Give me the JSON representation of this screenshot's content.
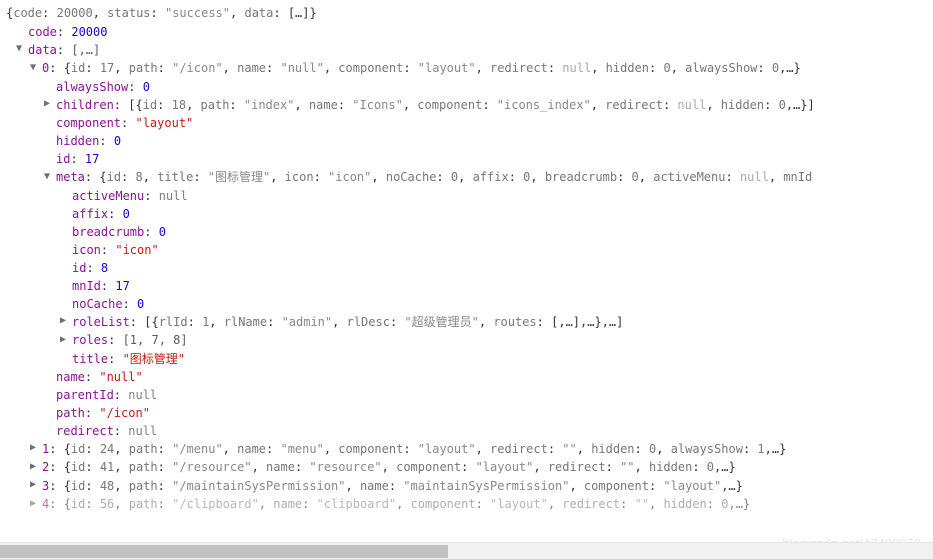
{
  "root": {
    "summary_open": "{",
    "summary_close": "}",
    "code_key": "code",
    "code_val": "20000",
    "status_key": "status",
    "status_val": "\"success\"",
    "data_key": "data",
    "data_preview": "[…]"
  },
  "l2_code": {
    "key": "code",
    "val": "20000"
  },
  "l2_data": {
    "key": "data",
    "val": "[,…]"
  },
  "item0": {
    "idx": "0",
    "preview_parts": {
      "id_k": "id",
      "id_v": "17",
      "path_k": "path",
      "path_v": "\"/icon\"",
      "name_k": "name",
      "name_v": "\"null\"",
      "comp_k": "component",
      "comp_v": "\"layout\"",
      "redir_k": "redirect",
      "redir_v": "null",
      "hidden_k": "hidden",
      "hidden_v": "0",
      "always_k": "alwaysShow",
      "always_v": "0"
    },
    "alwaysShow": {
      "key": "alwaysShow",
      "val": "0"
    },
    "children": {
      "key": "children",
      "p": {
        "id_k": "id",
        "id_v": "18",
        "path_k": "path",
        "path_v": "\"index\"",
        "name_k": "name",
        "name_v": "\"Icons\"",
        "comp_k": "component",
        "comp_v": "\"icons_index\"",
        "redir_k": "redirect",
        "redir_v": "null",
        "hidden_k": "hidden",
        "hidden_v": "0"
      }
    },
    "component": {
      "key": "component",
      "val": "\"layout\""
    },
    "hidden": {
      "key": "hidden",
      "val": "0"
    },
    "id": {
      "key": "id",
      "val": "17"
    },
    "meta": {
      "key": "meta",
      "p": {
        "id_k": "id",
        "id_v": "8",
        "title_k": "title",
        "title_v": "\"图标管理\"",
        "icon_k": "icon",
        "icon_v": "\"icon\"",
        "noc_k": "noCache",
        "noc_v": "0",
        "affix_k": "affix",
        "affix_v": "0",
        "bc_k": "breadcrumb",
        "bc_v": "0",
        "am_k": "activeMenu",
        "am_v": "null",
        "mnid_k": "mnId"
      },
      "activeMenu": {
        "key": "activeMenu",
        "val": "null"
      },
      "affix": {
        "key": "affix",
        "val": "0"
      },
      "breadcrumb": {
        "key": "breadcrumb",
        "val": "0"
      },
      "icon": {
        "key": "icon",
        "val": "\"icon\""
      },
      "id": {
        "key": "id",
        "val": "8"
      },
      "mnId": {
        "key": "mnId",
        "val": "17"
      },
      "noCache": {
        "key": "noCache",
        "val": "0"
      },
      "roleList": {
        "key": "roleList",
        "p": {
          "rlid_k": "rlId",
          "rlid_v": "1",
          "rlname_k": "rlName",
          "rlname_v": "\"admin\"",
          "rldesc_k": "rlDesc",
          "rldesc_v": "\"超级管理员\"",
          "routes_k": "routes",
          "routes_v": "[,…]"
        }
      },
      "roles": {
        "key": "roles",
        "val": "[1, 7, 8]"
      },
      "title": {
        "key": "title",
        "val": "\"图标管理\""
      }
    },
    "name": {
      "key": "name",
      "val": "\"null\""
    },
    "parentId": {
      "key": "parentId",
      "val": "null"
    },
    "path": {
      "key": "path",
      "val": "\"/icon\""
    },
    "redirect": {
      "key": "redirect",
      "val": "null"
    }
  },
  "item1": {
    "idx": "1",
    "p": {
      "id_k": "id",
      "id_v": "24",
      "path_k": "path",
      "path_v": "\"/menu\"",
      "name_k": "name",
      "name_v": "\"menu\"",
      "comp_k": "component",
      "comp_v": "\"layout\"",
      "redir_k": "redirect",
      "redir_v": "\"\"",
      "hidden_k": "hidden",
      "hidden_v": "0",
      "always_k": "alwaysShow",
      "always_v": "1"
    }
  },
  "item2": {
    "idx": "2",
    "p": {
      "id_k": "id",
      "id_v": "41",
      "path_k": "path",
      "path_v": "\"/resource\"",
      "name_k": "name",
      "name_v": "\"resource\"",
      "comp_k": "component",
      "comp_v": "\"layout\"",
      "redir_k": "redirect",
      "redir_v": "\"\"",
      "hidden_k": "hidden",
      "hidden_v": "0"
    }
  },
  "item3": {
    "idx": "3",
    "p": {
      "id_k": "id",
      "id_v": "48",
      "path_k": "path",
      "path_v": "\"/maintainSysPermission\"",
      "name_k": "name",
      "name_v": "\"maintainSysPermission\"",
      "comp_k": "component",
      "comp_v": "\"layout\""
    }
  },
  "item4": {
    "idx": "4",
    "p": {
      "id_k": "id",
      "id_v": "56",
      "path_k": "path",
      "path_v": "\"/clipboard\"",
      "name_k": "name",
      "name_v": "\"clipboard\"",
      "comp_k": "component",
      "comp_v": "\"layout\"",
      "redir_k": "redirect",
      "redir_v": "\"\"",
      "hidden_k": "hidden",
      "hidden_v": "0"
    }
  },
  "watermark": "blog.csdn.net/42499670"
}
